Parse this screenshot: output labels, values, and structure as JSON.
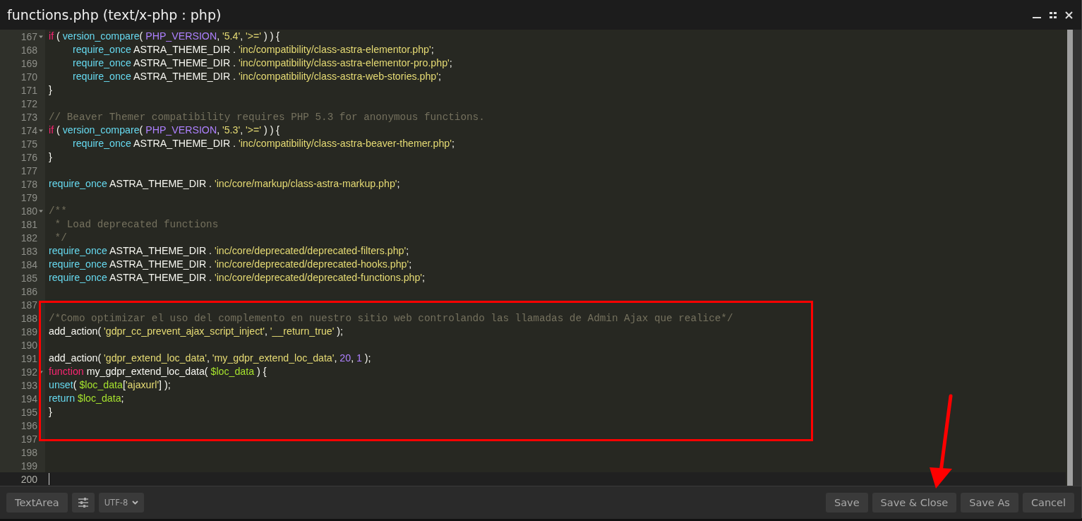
{
  "window": {
    "title": "functions.php (text/x-php : php)"
  },
  "editor": {
    "lines": [
      {
        "number": "167",
        "fold": true,
        "indented": false,
        "current": false,
        "tokens": [
          {
            "kind": "kw",
            "text": "if"
          },
          {
            "kind": "plain",
            "text": " ( "
          },
          {
            "kind": "fn",
            "text": "version_compare"
          },
          {
            "kind": "plain",
            "text": "( "
          },
          {
            "kind": "const",
            "text": "PHP_VERSION"
          },
          {
            "kind": "plain",
            "text": ", "
          },
          {
            "kind": "str",
            "text": "'5.4'"
          },
          {
            "kind": "plain",
            "text": ", "
          },
          {
            "kind": "str",
            "text": "'>='"
          },
          {
            "kind": "plain",
            "text": " ) ) {"
          }
        ]
      },
      {
        "number": "168",
        "fold": false,
        "indented": true,
        "current": false,
        "tokens": [
          {
            "kind": "fn",
            "text": "require_once"
          },
          {
            "kind": "plain",
            "text": " ASTRA_THEME_DIR . "
          },
          {
            "kind": "str",
            "text": "'inc/compatibility/class-astra-elementor.php'"
          },
          {
            "kind": "plain",
            "text": ";"
          }
        ]
      },
      {
        "number": "169",
        "fold": false,
        "indented": true,
        "current": false,
        "tokens": [
          {
            "kind": "fn",
            "text": "require_once"
          },
          {
            "kind": "plain",
            "text": " ASTRA_THEME_DIR . "
          },
          {
            "kind": "str",
            "text": "'inc/compatibility/class-astra-elementor-pro.php'"
          },
          {
            "kind": "plain",
            "text": ";"
          }
        ]
      },
      {
        "number": "170",
        "fold": false,
        "indented": true,
        "current": false,
        "tokens": [
          {
            "kind": "fn",
            "text": "require_once"
          },
          {
            "kind": "plain",
            "text": " ASTRA_THEME_DIR . "
          },
          {
            "kind": "str",
            "text": "'inc/compatibility/class-astra-web-stories.php'"
          },
          {
            "kind": "plain",
            "text": ";"
          }
        ]
      },
      {
        "number": "171",
        "fold": false,
        "indented": false,
        "current": false,
        "tokens": [
          {
            "kind": "plain",
            "text": "}"
          }
        ]
      },
      {
        "number": "172",
        "fold": false,
        "current": false
      },
      {
        "number": "173",
        "fold": false,
        "indented": false,
        "current": false,
        "tokens": [
          {
            "kind": "comment",
            "text": "// Beaver Themer compatibility requires PHP 5.3 for anonymous functions."
          }
        ]
      },
      {
        "number": "174",
        "fold": true,
        "indented": false,
        "current": false,
        "tokens": [
          {
            "kind": "kw",
            "text": "if"
          },
          {
            "kind": "plain",
            "text": " ( "
          },
          {
            "kind": "fn",
            "text": "version_compare"
          },
          {
            "kind": "plain",
            "text": "( "
          },
          {
            "kind": "const",
            "text": "PHP_VERSION"
          },
          {
            "kind": "plain",
            "text": ", "
          },
          {
            "kind": "str",
            "text": "'5.3'"
          },
          {
            "kind": "plain",
            "text": ", "
          },
          {
            "kind": "str",
            "text": "'>='"
          },
          {
            "kind": "plain",
            "text": " ) ) {"
          }
        ]
      },
      {
        "number": "175",
        "fold": false,
        "indented": true,
        "current": false,
        "tokens": [
          {
            "kind": "fn",
            "text": "require_once"
          },
          {
            "kind": "plain",
            "text": " ASTRA_THEME_DIR . "
          },
          {
            "kind": "str",
            "text": "'inc/compatibility/class-astra-beaver-themer.php'"
          },
          {
            "kind": "plain",
            "text": ";"
          }
        ]
      },
      {
        "number": "176",
        "fold": false,
        "indented": false,
        "current": false,
        "tokens": [
          {
            "kind": "plain",
            "text": "}"
          }
        ]
      },
      {
        "number": "177",
        "fold": false,
        "current": false
      },
      {
        "number": "178",
        "fold": false,
        "indented": false,
        "current": false,
        "tokens": [
          {
            "kind": "fn",
            "text": "require_once"
          },
          {
            "kind": "plain",
            "text": " ASTRA_THEME_DIR . "
          },
          {
            "kind": "str",
            "text": "'inc/core/markup/class-astra-markup.php'"
          },
          {
            "kind": "plain",
            "text": ";"
          }
        ]
      },
      {
        "number": "179",
        "fold": false,
        "current": false
      },
      {
        "number": "180",
        "fold": true,
        "indented": false,
        "current": false,
        "tokens": [
          {
            "kind": "comment",
            "text": "/**"
          }
        ]
      },
      {
        "number": "181",
        "fold": false,
        "indented": false,
        "current": false,
        "tokens": [
          {
            "kind": "comment",
            "text": " * Load deprecated functions"
          }
        ]
      },
      {
        "number": "182",
        "fold": false,
        "indented": false,
        "current": false,
        "tokens": [
          {
            "kind": "comment",
            "text": " */"
          }
        ]
      },
      {
        "number": "183",
        "fold": false,
        "indented": false,
        "current": false,
        "tokens": [
          {
            "kind": "fn",
            "text": "require_once"
          },
          {
            "kind": "plain",
            "text": " ASTRA_THEME_DIR . "
          },
          {
            "kind": "str",
            "text": "'inc/core/deprecated/deprecated-filters.php'"
          },
          {
            "kind": "plain",
            "text": ";"
          }
        ]
      },
      {
        "number": "184",
        "fold": false,
        "indented": false,
        "current": false,
        "tokens": [
          {
            "kind": "fn",
            "text": "require_once"
          },
          {
            "kind": "plain",
            "text": " ASTRA_THEME_DIR . "
          },
          {
            "kind": "str",
            "text": "'inc/core/deprecated/deprecated-hooks.php'"
          },
          {
            "kind": "plain",
            "text": ";"
          }
        ]
      },
      {
        "number": "185",
        "fold": false,
        "indented": false,
        "current": false,
        "tokens": [
          {
            "kind": "fn",
            "text": "require_once"
          },
          {
            "kind": "plain",
            "text": " ASTRA_THEME_DIR . "
          },
          {
            "kind": "str",
            "text": "'inc/core/deprecated/deprecated-functions.php'"
          },
          {
            "kind": "plain",
            "text": ";"
          }
        ]
      },
      {
        "number": "186",
        "fold": false,
        "current": false
      },
      {
        "number": "187",
        "fold": false,
        "current": false
      },
      {
        "number": "188",
        "fold": false,
        "indented": false,
        "current": false,
        "tokens": [
          {
            "kind": "comment",
            "text": "/*Como optimizar el uso del complemento en nuestro sitio web controlando las llamadas de Admin Ajax que realice*/"
          }
        ]
      },
      {
        "number": "189",
        "fold": false,
        "indented": false,
        "current": false,
        "tokens": [
          {
            "kind": "plain",
            "text": "add_action( "
          },
          {
            "kind": "str",
            "text": "'gdpr_cc_prevent_ajax_script_inject'"
          },
          {
            "kind": "plain",
            "text": ", "
          },
          {
            "kind": "str",
            "text": "'__return_true'"
          },
          {
            "kind": "plain",
            "text": " );"
          }
        ]
      },
      {
        "number": "190",
        "fold": false,
        "current": false
      },
      {
        "number": "191",
        "fold": false,
        "indented": false,
        "current": false,
        "tokens": [
          {
            "kind": "plain",
            "text": "add_action( "
          },
          {
            "kind": "str",
            "text": "'gdpr_extend_loc_data'"
          },
          {
            "kind": "plain",
            "text": ", "
          },
          {
            "kind": "str",
            "text": "'my_gdpr_extend_loc_data'"
          },
          {
            "kind": "plain",
            "text": ", "
          },
          {
            "kind": "num",
            "text": "20"
          },
          {
            "kind": "plain",
            "text": ", "
          },
          {
            "kind": "num",
            "text": "1"
          },
          {
            "kind": "plain",
            "text": " );"
          }
        ]
      },
      {
        "number": "192",
        "fold": true,
        "indented": false,
        "current": false,
        "tokens": [
          {
            "kind": "kw",
            "text": "function"
          },
          {
            "kind": "plain",
            "text": " my_gdpr_extend_loc_data( "
          },
          {
            "kind": "var",
            "text": "$loc_data"
          },
          {
            "kind": "plain",
            "text": " ) {"
          }
        ]
      },
      {
        "number": "193",
        "fold": false,
        "indented": false,
        "current": false,
        "tokens": [
          {
            "kind": "fn",
            "text": "unset"
          },
          {
            "kind": "plain",
            "text": "( "
          },
          {
            "kind": "var",
            "text": "$loc_data"
          },
          {
            "kind": "plain",
            "text": "["
          },
          {
            "kind": "str",
            "text": "'ajaxurl'"
          },
          {
            "kind": "plain",
            "text": "] );"
          }
        ]
      },
      {
        "number": "194",
        "fold": false,
        "indented": false,
        "current": false,
        "tokens": [
          {
            "kind": "fn",
            "text": "return"
          },
          {
            "kind": "var",
            "text": " $loc_data"
          },
          {
            "kind": "plain",
            "text": ";"
          }
        ]
      },
      {
        "number": "195",
        "fold": false,
        "indented": false,
        "current": false,
        "tokens": [
          {
            "kind": "plain",
            "text": "}"
          }
        ]
      },
      {
        "number": "196",
        "fold": false,
        "current": false
      },
      {
        "number": "197",
        "fold": false,
        "current": false
      },
      {
        "number": "198",
        "fold": false,
        "current": false
      },
      {
        "number": "199",
        "fold": false,
        "current": false
      },
      {
        "number": "200",
        "fold": false,
        "current": true
      }
    ]
  },
  "footer": {
    "mode_button": "TextArea",
    "encoding": "UTF-8",
    "buttons": [
      "Save",
      "Save & Close",
      "Save As",
      "Cancel"
    ]
  }
}
